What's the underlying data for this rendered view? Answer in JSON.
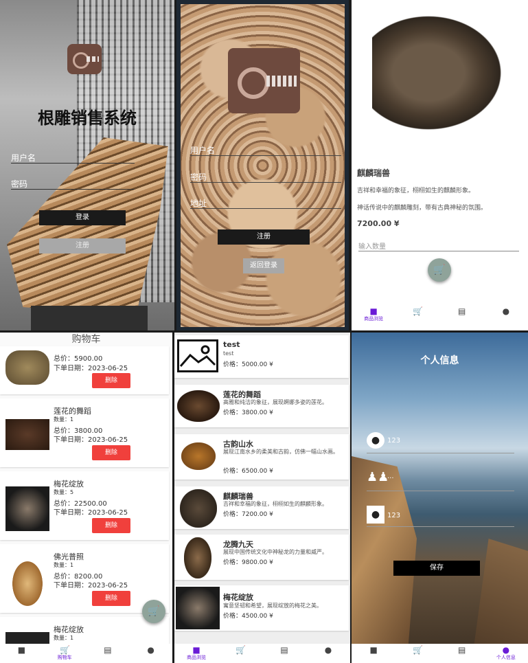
{
  "login": {
    "title": "根雕销售系统",
    "username_label": "用户名",
    "password_label": "密码",
    "login_button": "登录",
    "register_button": "注册"
  },
  "register": {
    "username_label": "用户名",
    "password_label": "密码",
    "address_label": "地址",
    "register_button": "注册",
    "back_button": "返回登录"
  },
  "detail": {
    "name": "麒麟瑞兽",
    "desc1": "吉祥和幸福的象征，栩栩如生的麒麟形象。",
    "desc2": "神话传说中的麒麟雕刻，带有古典神秘的氛围。",
    "price": "7200.00 ¥",
    "quantity_placeholder": "输入数量"
  },
  "nav": {
    "browse": "商品浏览",
    "cart": "购物车",
    "orders": "",
    "profile": "个人信息"
  },
  "cart": {
    "title": "购物车",
    "delete_label": "删除",
    "items": [
      {
        "name": "",
        "qty": "",
        "total": "总价：5900.00",
        "date": "下单日期：2023-06-25"
      },
      {
        "name": "莲花的舞蹈",
        "qty": "数量：1",
        "total": "总价：3800.00",
        "date": "下单日期：2023-06-25"
      },
      {
        "name": "梅花绽放",
        "qty": "数量：5",
        "total": "总价：22500.00",
        "date": "下单日期：2023-06-25"
      },
      {
        "name": "佛光普照",
        "qty": "数量：1",
        "total": "总价：8200.00",
        "date": "下单日期：2023-06-25"
      },
      {
        "name": "梅花绽放",
        "qty": "数量：1",
        "total": "",
        "date": ""
      }
    ]
  },
  "list": {
    "items": [
      {
        "name": "test",
        "desc": "test",
        "price": "价格：5000.00 ¥"
      },
      {
        "name": "莲花的舞蹈",
        "desc": "高雅和纯洁的象征，展现婀娜多姿的莲花。",
        "price": "价格：3800.00 ¥"
      },
      {
        "name": "古韵山水",
        "desc": "展现江南水乡的柔美和古韵，仿佛一幅山水画。",
        "price": "价格：6500.00 ¥"
      },
      {
        "name": "麒麟瑞兽",
        "desc": "吉祥和幸福的象征，栩栩如生的麒麟形象。",
        "price": "价格：7200.00 ¥"
      },
      {
        "name": "龙腾九天",
        "desc": "展现中国传统文化中神秘龙的力量和威严。",
        "price": "价格：9800.00 ¥"
      },
      {
        "name": "梅花绽放",
        "desc": "寓意坚韧和希望，展现绽放的梅花之美。",
        "price": "价格：4500.00 ¥"
      }
    ]
  },
  "profile": {
    "title": "个人信息",
    "username_value": "123",
    "password_value": "···",
    "address_value": "123",
    "save_button": "保存"
  },
  "colors": {
    "accent": "#6a1bd6",
    "danger": "#f0403c",
    "button_dark": "#1a1a1a",
    "button_gray": "#a8a8a8"
  }
}
